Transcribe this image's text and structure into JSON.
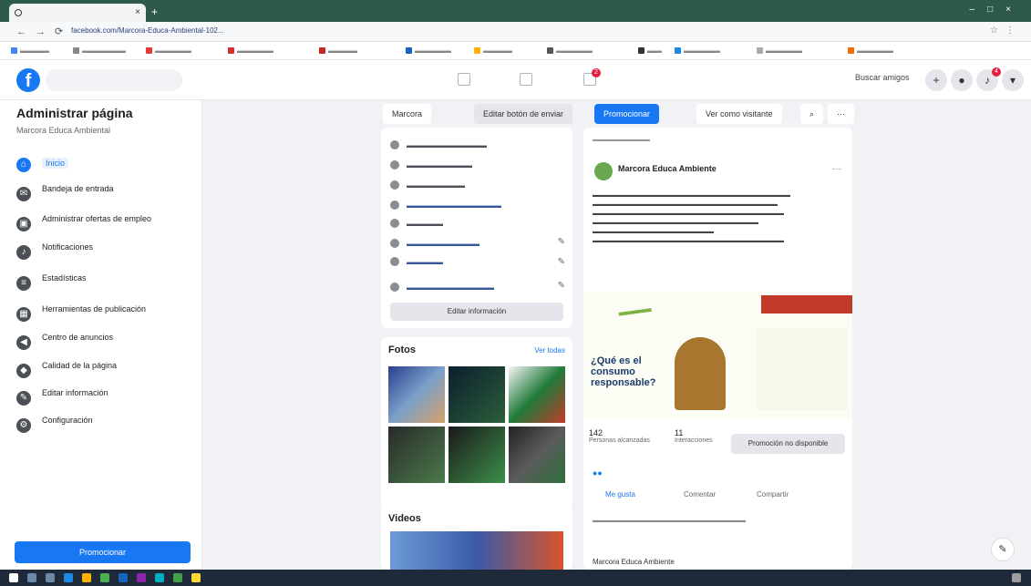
{
  "browser": {
    "tab_title": "",
    "url": "facebook.com/Marcora-Educa-Ambiental-102..."
  },
  "topbar": {
    "search_placeholder": "",
    "user_name": "Buscar amigos",
    "nav_badge": "2",
    "notif_badge": "4"
  },
  "sidebar": {
    "title": "Administrar página",
    "page_name": "Marcora Educa Ambiental",
    "items": [
      {
        "label": "Inicio",
        "sub": ""
      },
      {
        "label": "Bandeja de entrada",
        "sub": ""
      },
      {
        "label": "Administrar ofertas de empleo",
        "sub": ""
      },
      {
        "label": "Notificaciones",
        "sub": ""
      },
      {
        "label": "Estadísticas",
        "sub": ""
      },
      {
        "label": "Herramientas de publicación",
        "sub": ""
      },
      {
        "label": "Centro de anuncios",
        "sub": ""
      },
      {
        "label": "Calidad de la página",
        "sub": ""
      },
      {
        "label": "Editar información",
        "sub": ""
      },
      {
        "label": "Configuración",
        "sub": ""
      }
    ],
    "promote_label": "Promocionar"
  },
  "header": {
    "buttons": [
      "Marcora",
      "Editar botón de enviar",
      "Promocionar",
      "Ver como visitante"
    ]
  },
  "info": {
    "edit_label": "Editar información"
  },
  "photos": {
    "title": "Fotos",
    "see_all": "Ver todas"
  },
  "videos": {
    "title": "Videos"
  },
  "post": {
    "author": "Marcora Educa Ambiente",
    "image_title": "¿Qué es el consumo responsable?",
    "stats": {
      "reached": "142",
      "reached_label": "Personas alcanzadas",
      "interactions": "11",
      "interactions_label": "Interacciones"
    },
    "promote_disabled": "Promoción no disponible",
    "actions": [
      "Me gusta",
      "Comentar",
      "Compartir"
    ],
    "next_author": "Marcora Educa Ambiente"
  }
}
